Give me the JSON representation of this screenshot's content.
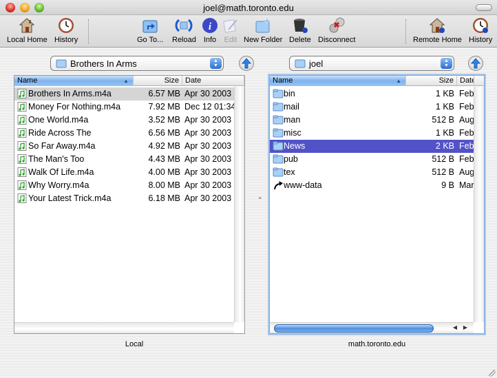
{
  "window": {
    "title": "joel@math.toronto.edu"
  },
  "toolbar": {
    "items": [
      {
        "id": "local-home",
        "label": "Local Home",
        "icon": "house-icon",
        "enabled": true
      },
      {
        "id": "history-local",
        "label": "History",
        "icon": "clock-icon",
        "enabled": true
      },
      {
        "id": "go-to",
        "label": "Go To...",
        "icon": "goto-folder-icon",
        "enabled": true
      },
      {
        "id": "reload",
        "label": "Reload",
        "icon": "reload-icon",
        "enabled": true
      },
      {
        "id": "info",
        "label": "Info",
        "icon": "info-icon",
        "enabled": true
      },
      {
        "id": "edit",
        "label": "Edit",
        "icon": "edit-icon",
        "enabled": false
      },
      {
        "id": "new-folder",
        "label": "New Folder",
        "icon": "new-folder-icon",
        "enabled": true
      },
      {
        "id": "delete",
        "label": "Delete",
        "icon": "trash-icon",
        "enabled": true
      },
      {
        "id": "disconnect",
        "label": "Disconnect",
        "icon": "disconnect-icon",
        "enabled": true
      },
      {
        "id": "remote-home",
        "label": "Remote Home",
        "icon": "remote-house-icon",
        "enabled": true
      },
      {
        "id": "history-remote",
        "label": "History",
        "icon": "remote-clock-icon",
        "enabled": true
      }
    ]
  },
  "local": {
    "path": "Brothers In Arms",
    "label": "Local",
    "columns": {
      "name": "Name",
      "size": "Size",
      "date": "Date"
    },
    "sorted_by": "Name",
    "selected_index": 0,
    "files": [
      {
        "name": "Brothers In Arms.m4a",
        "size": "6.57 MB",
        "date": "Apr 30 2003",
        "type": "audio"
      },
      {
        "name": "Money For Nothing.m4a",
        "size": "7.92 MB",
        "date": "Dec 12 01:34",
        "type": "audio"
      },
      {
        "name": "One World.m4a",
        "size": "3.52 MB",
        "date": "Apr 30 2003",
        "type": "audio"
      },
      {
        "name": "Ride Across The",
        "size": "6.56 MB",
        "date": "Apr 30 2003",
        "type": "audio"
      },
      {
        "name": "So Far Away.m4a",
        "size": "4.92 MB",
        "date": "Apr 30 2003",
        "type": "audio"
      },
      {
        "name": "The Man's Too",
        "size": "4.43 MB",
        "date": "Apr 30 2003",
        "type": "audio"
      },
      {
        "name": "Walk Of Life.m4a",
        "size": "4.00 MB",
        "date": "Apr 30 2003",
        "type": "audio"
      },
      {
        "name": "Why Worry.m4a",
        "size": "8.00 MB",
        "date": "Apr 30 2003",
        "type": "audio"
      },
      {
        "name": "Your Latest Trick.m4a",
        "size": "6.18 MB",
        "date": "Apr 30 2003",
        "type": "audio"
      }
    ]
  },
  "remote": {
    "path": "joel",
    "label": "math.toronto.edu",
    "columns": {
      "name": "Name",
      "size": "Size",
      "date": "Date"
    },
    "sorted_by": "Name",
    "selected_index": 4,
    "files": [
      {
        "name": "bin",
        "size": "1 KB",
        "date": "Feb",
        "type": "folder"
      },
      {
        "name": "mail",
        "size": "1 KB",
        "date": "Feb",
        "type": "folder"
      },
      {
        "name": "man",
        "size": "512 B",
        "date": "Aug",
        "type": "folder"
      },
      {
        "name": "misc",
        "size": "1 KB",
        "date": "Feb",
        "type": "folder"
      },
      {
        "name": "News",
        "size": "2 KB",
        "date": "Feb",
        "type": "folder"
      },
      {
        "name": "pub",
        "size": "512 B",
        "date": "Feb",
        "type": "folder"
      },
      {
        "name": "tex",
        "size": "512 B",
        "date": "Aug",
        "type": "folder"
      },
      {
        "name": "www-data",
        "size": "9 B",
        "date": "Mar",
        "type": "symlink"
      }
    ]
  },
  "colors": {
    "selection_active": "#5252c8",
    "selection_inactive": "#d5d5d5",
    "accent": "#2b6fd1"
  }
}
